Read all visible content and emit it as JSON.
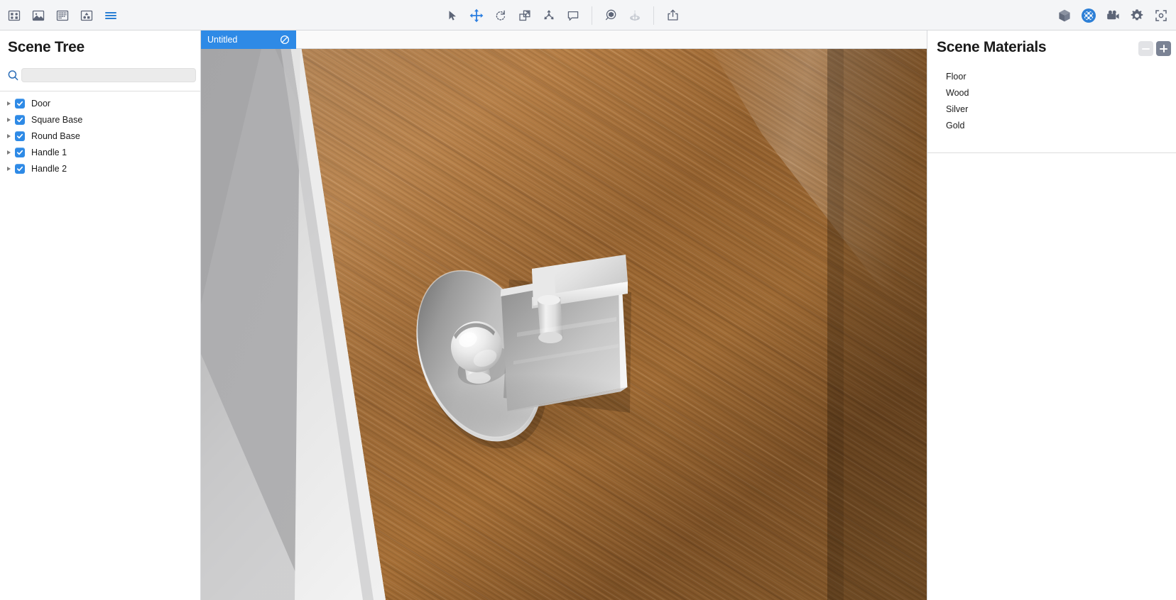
{
  "app": {
    "accent_blue": "#2e8ae6",
    "toolbar_icon_gray": "#5d6577",
    "panel_bg": "#ffffff",
    "toolbar_bg": "#f4f5f7"
  },
  "toolbar": {
    "left_tools": [
      {
        "name": "gallery-grid-icon",
        "label": "Gallery",
        "active": false
      },
      {
        "name": "image-icon",
        "label": "Image",
        "active": false
      },
      {
        "name": "thumbnails-icon",
        "label": "Thumbnails",
        "active": false
      },
      {
        "name": "scene-icon",
        "label": "Scene",
        "active": false
      },
      {
        "name": "list-view-icon",
        "label": "List",
        "active": true
      }
    ],
    "center_tools": [
      {
        "name": "select-arrow-icon",
        "label": "Select",
        "active": false
      },
      {
        "name": "move-icon",
        "label": "Move",
        "active": true
      },
      {
        "name": "rotate-icon",
        "label": "Rotate",
        "active": false
      },
      {
        "name": "scale-icon",
        "label": "Scale",
        "active": false
      },
      {
        "name": "explode-icon",
        "label": "Explode",
        "active": false
      },
      {
        "name": "comment-icon",
        "label": "Comment",
        "active": false
      }
    ],
    "center_tools_group2": [
      {
        "name": "inspect-object-icon",
        "label": "Inspect",
        "active": false
      },
      {
        "name": "pedestal-icon",
        "label": "Pedestal",
        "active": false,
        "disabled": true
      }
    ],
    "center_tools_group3": [
      {
        "name": "share-export-icon",
        "label": "Share",
        "active": false
      }
    ],
    "right_tools": [
      {
        "name": "cube-icon",
        "label": "Geometry",
        "active": false
      },
      {
        "name": "materials-sphere-icon",
        "label": "Materials",
        "active": true
      },
      {
        "name": "video-camera-icon",
        "label": "Camera",
        "active": false
      },
      {
        "name": "gear-icon",
        "label": "Settings",
        "active": false
      },
      {
        "name": "viewfinder-icon",
        "label": "Focus",
        "active": false
      }
    ]
  },
  "scene_tree": {
    "title": "Scene Tree",
    "search": {
      "value": "",
      "placeholder": ""
    },
    "items": [
      {
        "label": "Door",
        "checked": true,
        "expanded": false
      },
      {
        "label": "Square Base",
        "checked": true,
        "expanded": false
      },
      {
        "label": "Round Base",
        "checked": true,
        "expanded": false
      },
      {
        "label": "Handle 1",
        "checked": true,
        "expanded": false
      },
      {
        "label": "Handle 2",
        "checked": true,
        "expanded": false
      }
    ]
  },
  "scene_materials": {
    "title": "Scene Materials",
    "remove_label": "−",
    "add_label": "+",
    "items": [
      {
        "label": "Floor"
      },
      {
        "label": "Wood"
      },
      {
        "label": "Silver"
      },
      {
        "label": "Gold"
      }
    ]
  },
  "viewport": {
    "tab": {
      "label": "Untitled",
      "icon": "unsaved-indicator-icon"
    },
    "background_color": "#a9a9ab",
    "wall_color": "#a9a9ab",
    "floor_color": "#dedede",
    "door_wood_color": "#9c6b35",
    "metal_color": "#d8d8d8",
    "objects": [
      {
        "name": "door-panel",
        "material": "Wood"
      },
      {
        "name": "round-base",
        "material": "Silver"
      },
      {
        "name": "knob-handle",
        "material": "Silver"
      },
      {
        "name": "square-base",
        "material": "Silver"
      },
      {
        "name": "lever-handle",
        "material": "Silver"
      }
    ]
  }
}
